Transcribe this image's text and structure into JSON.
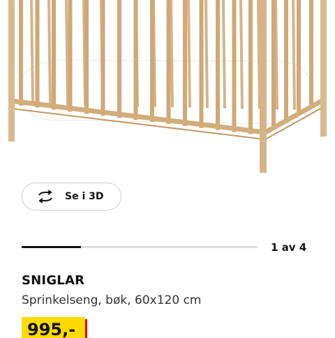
{
  "product_image": {
    "alt": "",
    "icon": "crib-illustration",
    "colors": {
      "wood": "#d6b488",
      "wood_dark": "#c29a66",
      "mattress": "#ffffff"
    }
  },
  "view_3d": {
    "label": "Se i 3D",
    "icon": "rotate-3d-icon"
  },
  "carousel": {
    "counter": "1 av 4",
    "current": 1,
    "total": 4,
    "progress_fraction": 0.25
  },
  "product": {
    "name": "SNIGLAR",
    "description": "Sprinkelseng, bøk, 60x120 cm",
    "price": "995,-"
  },
  "colors": {
    "price_bg": "#ffdb00",
    "price_shadow": "#e0001a",
    "text": "#111111"
  }
}
